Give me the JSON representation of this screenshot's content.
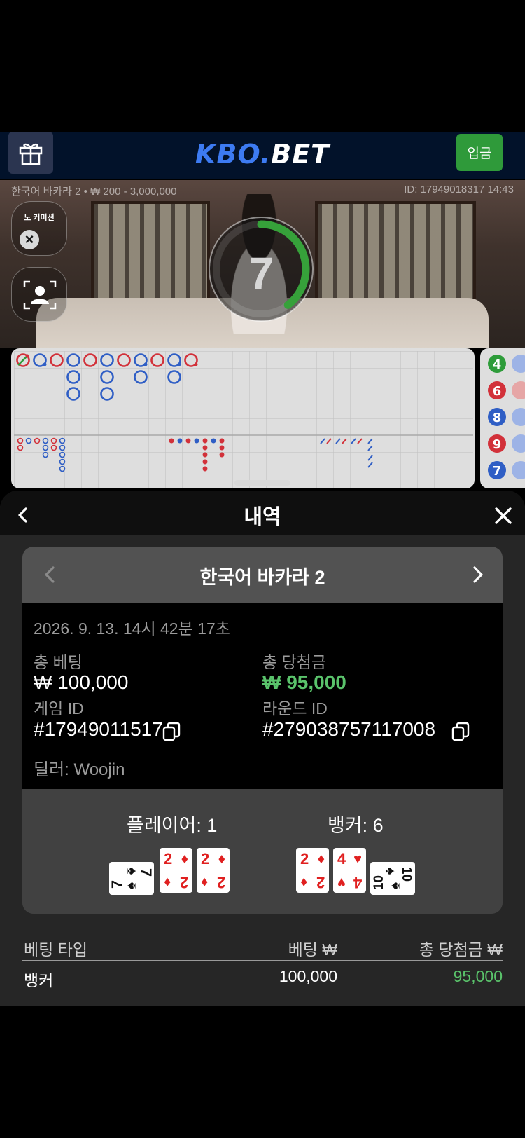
{
  "header": {
    "logo_kbo": "KBO.",
    "logo_bet": "BET",
    "deposit_label": "입금"
  },
  "video": {
    "table_info": "한국어 바카라 2 • ₩ 200 - 3,000,000",
    "id_time": "ID: 17949018317 14:43",
    "no_commission_label": "노 커미션",
    "timer_value": "7"
  },
  "beadplate": {
    "numbers": [
      "4",
      "6",
      "8",
      "9",
      "7"
    ]
  },
  "history": {
    "title": "내역",
    "game_name": "한국어 바카라 2",
    "datetime": "2026. 9. 13. 14시 42분 17초",
    "total_bet_label": "총 베팅",
    "total_bet_value": "₩ 100,000",
    "total_win_label": "총 당첨금",
    "total_win_value": "₩ 95,000",
    "game_id_label": "게임 ID",
    "game_id_value": "#17949011517",
    "round_id_label": "라운드 ID",
    "round_id_value": "#279038757117008",
    "dealer_label": "딜러: Woojin",
    "player_label": "플레이어: 1",
    "banker_label": "뱅커: 6",
    "player_cards": [
      {
        "rank": "7",
        "suit": "♠"
      },
      {
        "rank": "2",
        "suit": "♦"
      },
      {
        "rank": "2",
        "suit": "♦"
      }
    ],
    "banker_cards": [
      {
        "rank": "2",
        "suit": "♦"
      },
      {
        "rank": "4",
        "suit": "♥"
      },
      {
        "rank": "10",
        "suit": "♠"
      }
    ]
  },
  "bets_table": {
    "col_type": "베팅 타입",
    "col_bet": "베팅 ₩",
    "col_win": "총 당첨금 ₩",
    "rows": [
      {
        "type": "뱅커",
        "bet": "100,000",
        "win": "95,000"
      }
    ]
  },
  "colors": {
    "deposit_green": "#2f9a3a",
    "win_green": "#5ac36b",
    "logo_blue": "#3d7bf2"
  }
}
